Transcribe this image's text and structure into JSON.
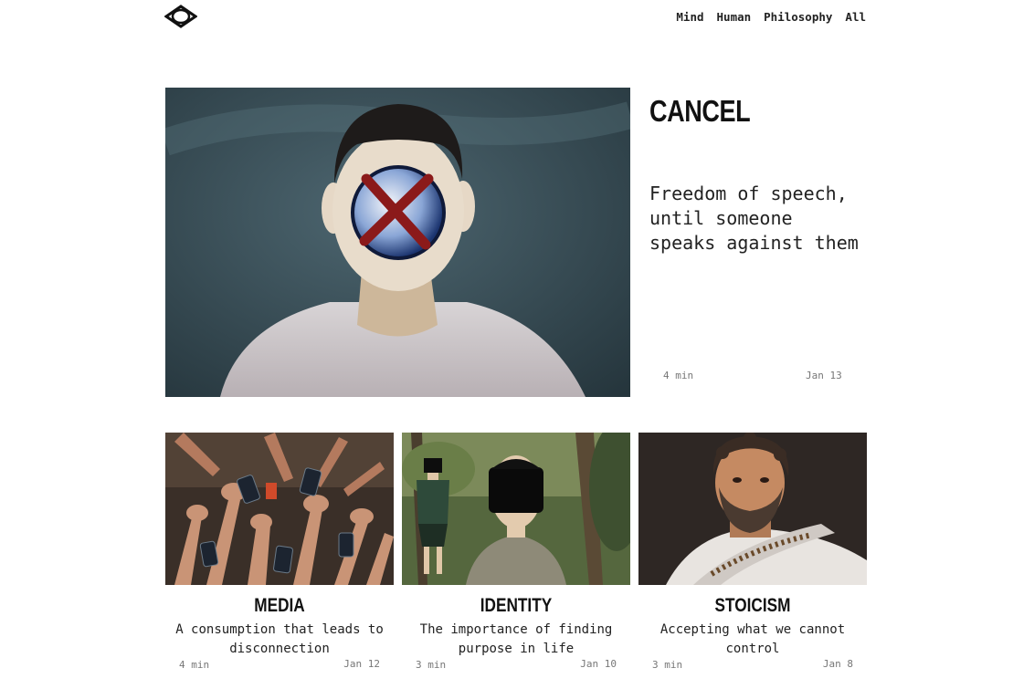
{
  "nav": {
    "logo_icon": "eye-diamond-icon",
    "items": [
      "Mind",
      "Human",
      "Philosophy",
      "All"
    ]
  },
  "featured": {
    "title": "CANCEL",
    "subtitle": "Freedom of speech, until someone speaks against them",
    "read_time": "4 min",
    "date": "Jan 13",
    "image": "painting of man with red X over face"
  },
  "cards": [
    {
      "title": "MEDIA",
      "description": "A consumption that leads to disconnection",
      "read_time": "4 min",
      "date": "Jan 12",
      "image": "hands reaching for phones"
    },
    {
      "title": "IDENTITY",
      "description": "The importance of finding purpose in life",
      "read_time": "3 min",
      "date": "Jan 10",
      "image": "faceless figures in forest"
    },
    {
      "title": "STOICISM",
      "description": "Accepting what we cannot control",
      "read_time": "3 min",
      "date": "Jan 8",
      "image": "roman stoic philosopher bust painting"
    }
  ],
  "colors": {
    "accent_x": "#8b1a1a",
    "background": "#ffffff"
  }
}
